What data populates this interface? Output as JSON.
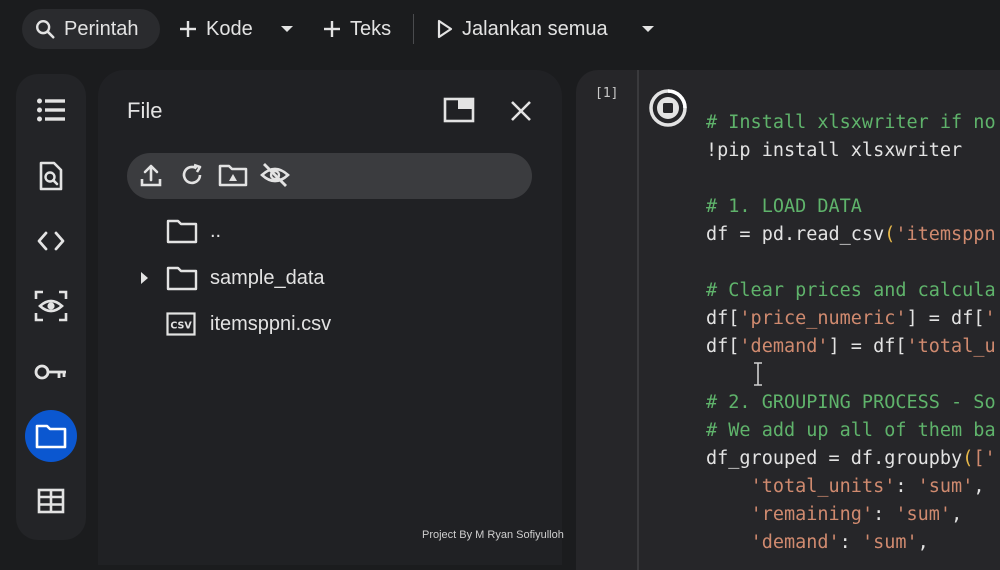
{
  "toolbar": {
    "search_label": "Perintah",
    "code_label": "Kode",
    "text_label": "Teks",
    "run_all_label": "Jalankan semua"
  },
  "rail": {
    "items": [
      {
        "icon": "table-of-contents-icon"
      },
      {
        "icon": "find-replace-icon"
      },
      {
        "icon": "code-snippets-icon"
      },
      {
        "icon": "variables-icon"
      },
      {
        "icon": "secrets-key-icon"
      },
      {
        "icon": "folder-icon",
        "active": true
      },
      {
        "icon": "data-table-icon"
      }
    ]
  },
  "files": {
    "title": "File",
    "tree": [
      {
        "name": "..",
        "type": "folder"
      },
      {
        "name": "sample_data",
        "type": "folder",
        "expandable": true
      },
      {
        "name": "itemsppni.csv",
        "type": "csv"
      }
    ]
  },
  "cell": {
    "execution_count": "[1]",
    "lines": [
      [
        {
          "t": "# Install xlsxwriter if no",
          "c": "cmt"
        }
      ],
      [
        {
          "t": "!pip install xlsxwriter",
          "c": ""
        }
      ],
      [],
      [
        {
          "t": "# 1. LOAD DATA",
          "c": "cmt"
        }
      ],
      [
        {
          "t": "df = pd.read_csv",
          "c": ""
        },
        {
          "t": "(",
          "c": "par"
        },
        {
          "t": "'itemsppn",
          "c": "str"
        }
      ],
      [],
      [
        {
          "t": "# Clear prices and calcula",
          "c": "cmt"
        }
      ],
      [
        {
          "t": "df[",
          "c": ""
        },
        {
          "t": "'price_numeric'",
          "c": "str"
        },
        {
          "t": "] = df[",
          "c": ""
        },
        {
          "t": "'",
          "c": "str"
        }
      ],
      [
        {
          "t": "df[",
          "c": ""
        },
        {
          "t": "'demand'",
          "c": "str"
        },
        {
          "t": "] = df[",
          "c": ""
        },
        {
          "t": "'total_u",
          "c": "str"
        }
      ],
      [],
      [
        {
          "t": "# 2. GROUPING PROCESS - So",
          "c": "cmt"
        }
      ],
      [
        {
          "t": "# We add up all of them ba",
          "c": "cmt"
        }
      ],
      [
        {
          "t": "df_grouped = df.groupby",
          "c": ""
        },
        {
          "t": "(",
          "c": "par"
        },
        {
          "t": "['",
          "c": "str"
        }
      ],
      [
        {
          "t": "    ",
          "c": ""
        },
        {
          "t": "'total_units'",
          "c": "str"
        },
        {
          "t": ": ",
          "c": ""
        },
        {
          "t": "'sum'",
          "c": "str"
        },
        {
          "t": ",",
          "c": ""
        }
      ],
      [
        {
          "t": "    ",
          "c": ""
        },
        {
          "t": "'remaining'",
          "c": "str"
        },
        {
          "t": ": ",
          "c": ""
        },
        {
          "t": "'sum'",
          "c": "str"
        },
        {
          "t": ",",
          "c": ""
        }
      ],
      [
        {
          "t": "    ",
          "c": ""
        },
        {
          "t": "'demand'",
          "c": "str"
        },
        {
          "t": ": ",
          "c": ""
        },
        {
          "t": "'sum'",
          "c": "str"
        },
        {
          "t": ",",
          "c": ""
        }
      ]
    ]
  },
  "watermark": "Project By M Ryan Sofiyulloh",
  "colors": {
    "background": "#1b1c1e",
    "rail_active": "#0b57d0",
    "comment": "#5fb36b",
    "string": "#d08a6f",
    "paren": "#e8b94a"
  }
}
